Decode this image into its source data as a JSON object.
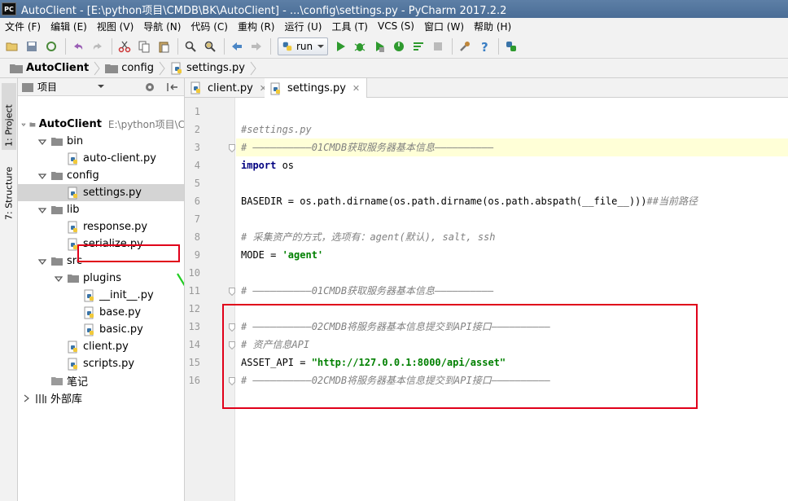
{
  "window": {
    "app_icon": "PC",
    "title": "AutoClient - [E:\\python项目\\CMDB\\BK\\AutoClient] - ...\\config\\settings.py - PyCharm 2017.2.2"
  },
  "menu": [
    "文件 (F)",
    "编辑 (E)",
    "视图 (V)",
    "导航 (N)",
    "代码 (C)",
    "重构 (R)",
    "运行 (U)",
    "工具 (T)",
    "VCS (S)",
    "窗口 (W)",
    "帮助 (H)"
  ],
  "toolbar": {
    "run_config": "run",
    "icons": [
      "open-folder-icon",
      "save-icon",
      "sync-icon",
      "undo-icon",
      "redo-icon",
      "cut-icon",
      "copy-icon",
      "paste-icon",
      "find-icon",
      "replace-icon",
      "back-icon",
      "forward-icon",
      "run-icon",
      "debug-icon",
      "coverage-icon",
      "profile-icon",
      "concurrency-icon",
      "stop-icon",
      "settings-icon",
      "help-icon",
      "python-console-icon"
    ]
  },
  "breadcrumb": [
    "AutoClient",
    "config",
    "settings.py"
  ],
  "side_tabs": {
    "project": "1: Project",
    "structure": "7: Structure"
  },
  "project_panel": {
    "label": "项目",
    "tree": [
      {
        "label": "AutoClient",
        "hint": "E:\\python项目\\C",
        "type": "folder",
        "depth": 0,
        "expanded": true,
        "bold": true
      },
      {
        "label": "bin",
        "type": "folder",
        "depth": 1,
        "expanded": true
      },
      {
        "label": "auto-client.py",
        "type": "py",
        "depth": 2
      },
      {
        "label": "config",
        "type": "folder",
        "depth": 1,
        "expanded": true
      },
      {
        "label": "settings.py",
        "type": "py",
        "depth": 2,
        "selected": true
      },
      {
        "label": "lib",
        "type": "folder",
        "depth": 1,
        "expanded": true
      },
      {
        "label": "response.py",
        "type": "py",
        "depth": 2
      },
      {
        "label": "serialize.py",
        "type": "py",
        "depth": 2
      },
      {
        "label": "src",
        "type": "folder",
        "depth": 1,
        "expanded": true
      },
      {
        "label": "plugins",
        "type": "folder",
        "depth": 2,
        "expanded": true
      },
      {
        "label": "__init__.py",
        "type": "py",
        "depth": 3
      },
      {
        "label": "base.py",
        "type": "py",
        "depth": 3
      },
      {
        "label": "basic.py",
        "type": "py",
        "depth": 3
      },
      {
        "label": "client.py",
        "type": "py",
        "depth": 2
      },
      {
        "label": "scripts.py",
        "type": "py",
        "depth": 2
      },
      {
        "label": "笔记",
        "type": "folder-plain",
        "depth": 1
      },
      {
        "label": "外部库",
        "type": "library",
        "depth": 0,
        "expanded": false
      }
    ]
  },
  "editor_tabs": [
    {
      "label": "client.py",
      "active": false
    },
    {
      "label": "settings.py",
      "active": true
    }
  ],
  "code": [
    {
      "n": "1",
      "text": ""
    },
    {
      "n": "2",
      "text": "#settings.py",
      "style": "cm"
    },
    {
      "n": "3",
      "text": "# ——————————01CMDB获取服务器基本信息——————————",
      "style": "cm",
      "hl": true
    },
    {
      "n": "4",
      "parts": [
        {
          "t": "import",
          "s": "kw"
        },
        {
          "t": " os",
          "s": ""
        }
      ]
    },
    {
      "n": "5",
      "text": ""
    },
    {
      "n": "6",
      "parts": [
        {
          "t": "BASEDIR = os.path.dirname(os.path.dirname(os.path.abspath(__file__)))",
          "s": ""
        },
        {
          "t": "##当前路径",
          "s": "cm"
        }
      ]
    },
    {
      "n": "7",
      "text": ""
    },
    {
      "n": "8",
      "text": "# 采集资产的方式，选项有：agent(默认), salt, ssh",
      "style": "cm"
    },
    {
      "n": "9",
      "parts": [
        {
          "t": "MODE = ",
          "s": ""
        },
        {
          "t": "'agent'",
          "s": "str"
        }
      ]
    },
    {
      "n": "10",
      "text": ""
    },
    {
      "n": "11",
      "text": "# ——————————01CMDB获取服务器基本信息——————————",
      "style": "cm"
    },
    {
      "n": "12",
      "text": ""
    },
    {
      "n": "13",
      "text": "# ——————————02CMDB将服务器基本信息提交到API接口——————————",
      "style": "cm"
    },
    {
      "n": "14",
      "text": "# 资产信息API",
      "style": "cm"
    },
    {
      "n": "15",
      "parts": [
        {
          "t": "ASSET_API = ",
          "s": ""
        },
        {
          "t": "\"http://127.0.0.1:8000/api/asset\"",
          "s": "str"
        }
      ]
    },
    {
      "n": "16",
      "text": "# ——————————02CMDB将服务器基本信息提交到API接口——————————",
      "style": "cm"
    }
  ],
  "colors": {
    "annotation_red": "#e0001a",
    "annotation_green": "#22cc22",
    "current_line": "#ffffd7"
  }
}
